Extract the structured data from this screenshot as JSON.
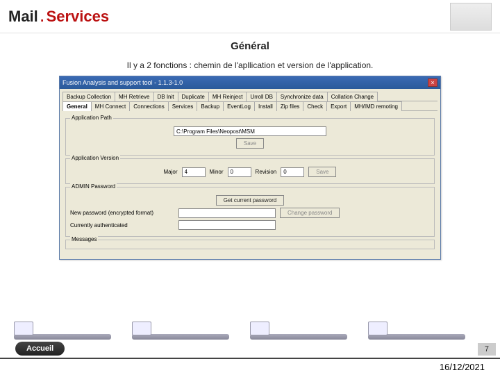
{
  "logo": {
    "mail": "Mail",
    "dot": ".",
    "services": "Services"
  },
  "title": "Général",
  "subtitle": "Il y a 2 fonctions : chemin de l'apllication et version de l'application.",
  "dialog": {
    "title": "Fusion Analysis and support tool - 1.1.3-1.0",
    "tabs_row1": [
      "Backup Collection",
      "MH Retrieve",
      "DB Init",
      "Duplicate",
      "MH Reinject",
      "Urroll DB",
      "Synchronize data",
      "Collation Change"
    ],
    "tabs_row2": [
      "General",
      "MH Connect",
      "Connections",
      "Services",
      "Backup",
      "EventLog",
      "Install",
      "Zip files",
      "Check",
      "Export",
      "MH/IMD remoting"
    ],
    "group_path": {
      "label": "Application Path",
      "value": "C:\\Program Files\\Neopost\\MSM",
      "save": "Save"
    },
    "group_version": {
      "label": "Application Version",
      "major_label": "Major",
      "major": "4",
      "minor_label": "Minor",
      "minor": "0",
      "rev_label": "Revision",
      "rev": "0",
      "save": "Save"
    },
    "group_password": {
      "label": "ADMIN Password",
      "get": "Get current password",
      "new_label": "New password (encrypted format)",
      "confirm_label": "Currently authenticated",
      "change": "Change password"
    },
    "group_messages": {
      "label": "Messages"
    }
  },
  "accueil": "Accueil",
  "page": "7",
  "date": "16/12/2021"
}
